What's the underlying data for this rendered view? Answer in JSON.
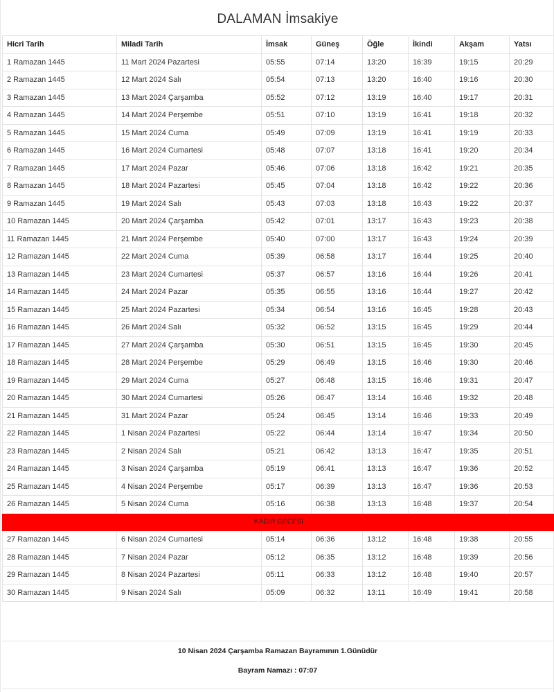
{
  "page": {
    "title": "DALAMAN İmsakiye"
  },
  "table": {
    "headers": [
      "Hicri Tarih",
      "Miladi Tarih",
      "İmsak",
      "Güneş",
      "Öğle",
      "İkindi",
      "Akşam",
      "Yatsı"
    ],
    "rows_before": [
      [
        "1 Ramazan 1445",
        "11 Mart 2024 Pazartesi",
        "05:55",
        "07:14",
        "13:20",
        "16:39",
        "19:15",
        "20:29"
      ],
      [
        "2 Ramazan 1445",
        "12 Mart 2024 Salı",
        "05:54",
        "07:13",
        "13:20",
        "16:40",
        "19:16",
        "20:30"
      ],
      [
        "3 Ramazan 1445",
        "13 Mart 2024 Çarşamba",
        "05:52",
        "07:12",
        "13:19",
        "16:40",
        "19:17",
        "20:31"
      ],
      [
        "4 Ramazan 1445",
        "14 Mart 2024 Perşembe",
        "05:51",
        "07:10",
        "13:19",
        "16:41",
        "19:18",
        "20:32"
      ],
      [
        "5 Ramazan 1445",
        "15 Mart 2024 Cuma",
        "05:49",
        "07:09",
        "13:19",
        "16:41",
        "19:19",
        "20:33"
      ],
      [
        "6 Ramazan 1445",
        "16 Mart 2024 Cumartesi",
        "05:48",
        "07:07",
        "13:18",
        "16:41",
        "19:20",
        "20:34"
      ],
      [
        "7 Ramazan 1445",
        "17 Mart 2024 Pazar",
        "05:46",
        "07:06",
        "13:18",
        "16:42",
        "19:21",
        "20:35"
      ],
      [
        "8 Ramazan 1445",
        "18 Mart 2024 Pazartesi",
        "05:45",
        "07:04",
        "13:18",
        "16:42",
        "19:22",
        "20:36"
      ],
      [
        "9 Ramazan 1445",
        "19 Mart 2024 Salı",
        "05:43",
        "07:03",
        "13:18",
        "16:43",
        "19:22",
        "20:37"
      ],
      [
        "10 Ramazan 1445",
        "20 Mart 2024 Çarşamba",
        "05:42",
        "07:01",
        "13:17",
        "16:43",
        "19:23",
        "20:38"
      ],
      [
        "11 Ramazan 1445",
        "21 Mart 2024 Perşembe",
        "05:40",
        "07:00",
        "13:17",
        "16:43",
        "19:24",
        "20:39"
      ],
      [
        "12 Ramazan 1445",
        "22 Mart 2024 Cuma",
        "05:39",
        "06:58",
        "13:17",
        "16:44",
        "19:25",
        "20:40"
      ],
      [
        "13 Ramazan 1445",
        "23 Mart 2024 Cumartesi",
        "05:37",
        "06:57",
        "13:16",
        "16:44",
        "19:26",
        "20:41"
      ],
      [
        "14 Ramazan 1445",
        "24 Mart 2024 Pazar",
        "05:35",
        "06:55",
        "13:16",
        "16:44",
        "19:27",
        "20:42"
      ],
      [
        "15 Ramazan 1445",
        "25 Mart 2024 Pazartesi",
        "05:34",
        "06:54",
        "13:16",
        "16:45",
        "19:28",
        "20:43"
      ],
      [
        "16 Ramazan 1445",
        "26 Mart 2024 Salı",
        "05:32",
        "06:52",
        "13:15",
        "16:45",
        "19:29",
        "20:44"
      ],
      [
        "17 Ramazan 1445",
        "27 Mart 2024 Çarşamba",
        "05:30",
        "06:51",
        "13:15",
        "16:45",
        "19:30",
        "20:45"
      ],
      [
        "18 Ramazan 1445",
        "28 Mart 2024 Perşembe",
        "05:29",
        "06:49",
        "13:15",
        "16:46",
        "19:30",
        "20:46"
      ],
      [
        "19 Ramazan 1445",
        "29 Mart 2024 Cuma",
        "05:27",
        "06:48",
        "13:15",
        "16:46",
        "19:31",
        "20:47"
      ],
      [
        "20 Ramazan 1445",
        "30 Mart 2024 Cumartesi",
        "05:26",
        "06:47",
        "13:14",
        "16:46",
        "19:32",
        "20:48"
      ],
      [
        "21 Ramazan 1445",
        "31 Mart 2024 Pazar",
        "05:24",
        "06:45",
        "13:14",
        "16:46",
        "19:33",
        "20:49"
      ],
      [
        "22 Ramazan 1445",
        "1 Nisan 2024 Pazartesi",
        "05:22",
        "06:44",
        "13:14",
        "16:47",
        "19:34",
        "20:50"
      ],
      [
        "23 Ramazan 1445",
        "2 Nisan 2024 Salı",
        "05:21",
        "06:42",
        "13:13",
        "16:47",
        "19:35",
        "20:51"
      ],
      [
        "24 Ramazan 1445",
        "3 Nisan 2024 Çarşamba",
        "05:19",
        "06:41",
        "13:13",
        "16:47",
        "19:36",
        "20:52"
      ],
      [
        "25 Ramazan 1445",
        "4 Nisan 2024 Perşembe",
        "05:17",
        "06:39",
        "13:13",
        "16:47",
        "19:36",
        "20:53"
      ],
      [
        "26 Ramazan 1445",
        "5 Nisan 2024 Cuma",
        "05:16",
        "06:38",
        "13:13",
        "16:48",
        "19:37",
        "20:54"
      ]
    ],
    "kadir_label": "KADIR GECESİ",
    "rows_after": [
      [
        "27 Ramazan 1445",
        "6 Nisan 2024 Cumartesi",
        "05:14",
        "06:36",
        "13:12",
        "16:48",
        "19:38",
        "20:55"
      ],
      [
        "28 Ramazan 1445",
        "7 Nisan 2024 Pazar",
        "05:12",
        "06:35",
        "13:12",
        "16:48",
        "19:39",
        "20:56"
      ],
      [
        "29 Ramazan 1445",
        "8 Nisan 2024 Pazartesi",
        "05:11",
        "06:33",
        "13:12",
        "16:48",
        "19:40",
        "20:57"
      ],
      [
        "30 Ramazan 1445",
        "9 Nisan 2024 Salı",
        "05:09",
        "06:32",
        "13:11",
        "16:49",
        "19:41",
        "20:58"
      ]
    ]
  },
  "footer": {
    "bayram_text": "10 Nisan 2024 Çarşamba Ramazan Bayramının 1.Günüdür",
    "namaz_text": "Bayram Namazı : 07:07"
  },
  "colors": {
    "kadir_row_bg": "#ff0000"
  }
}
